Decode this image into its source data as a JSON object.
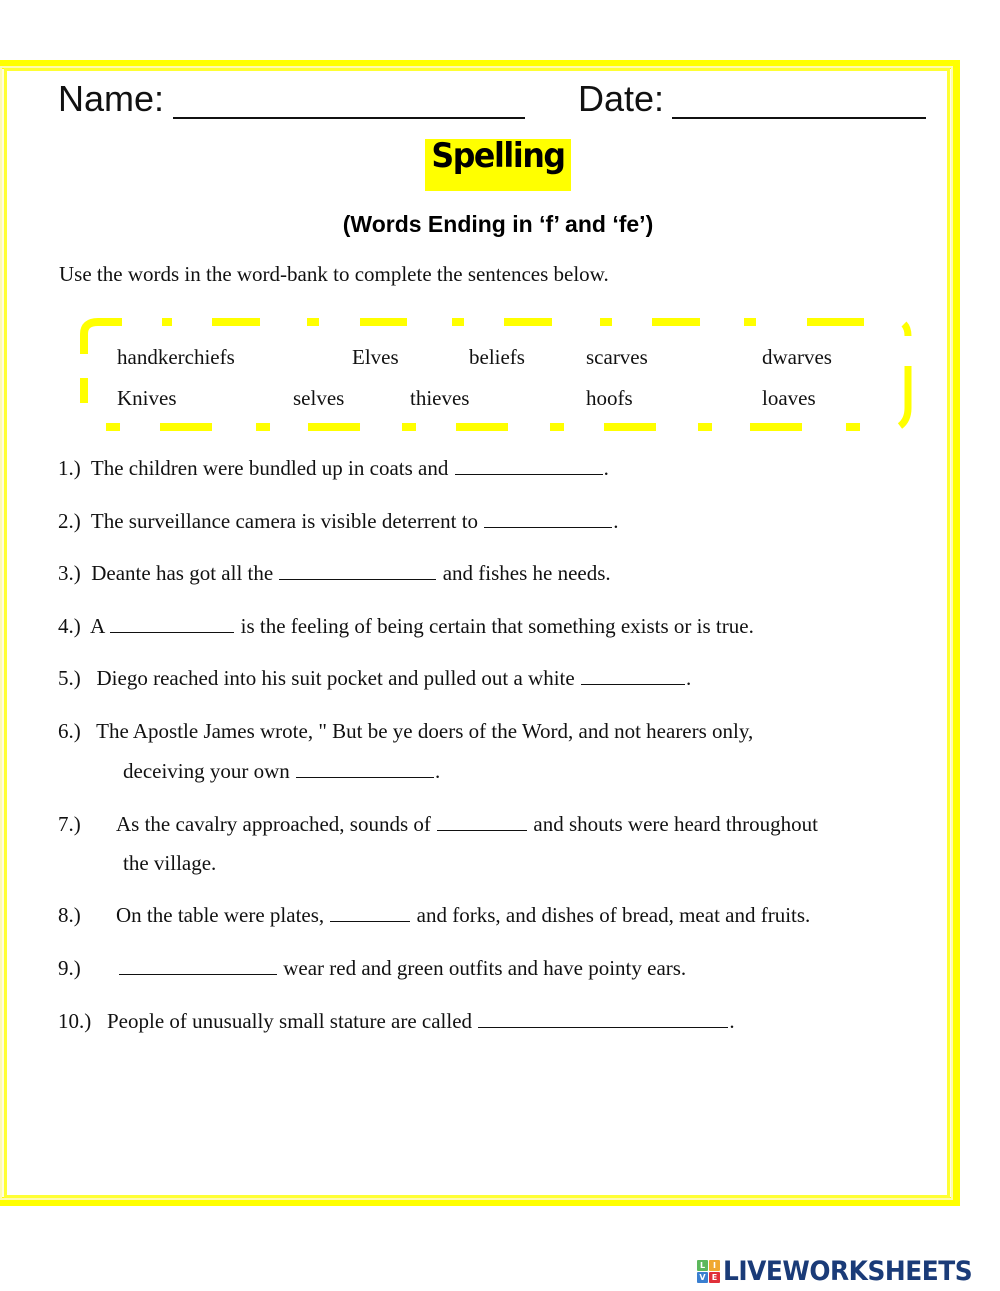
{
  "header": {
    "name_label": "Name:",
    "date_label": "Date:"
  },
  "title": "Spelling",
  "subtitle": "(Words Ending in ‘f’ and ‘fe’)",
  "instructions": "Use the words in the word-bank to complete the sentences below.",
  "word_bank": {
    "row1": [
      "handkerchiefs",
      "Elves",
      "beliefs",
      "scarves",
      "dwarves"
    ],
    "row2": [
      "Knives",
      "selves",
      "thieves",
      "hoofs",
      "loaves"
    ]
  },
  "questions": [
    {
      "num": "1.)",
      "before": "The children were bundled up in coats and",
      "after": "."
    },
    {
      "num": "2.)",
      "before": "The surveillance camera is visible deterrent to",
      "after": "."
    },
    {
      "num": "3.)",
      "before": "Deante has got all the",
      "after": "and fishes he needs."
    },
    {
      "num": "4.)",
      "before": "A",
      "after": "is the feeling of being certain that something exists or is true."
    },
    {
      "num": "5.)",
      "before": "Diego reached into his suit pocket and pulled out a white",
      "after": "."
    },
    {
      "num": "6.)",
      "before": "The Apostle James wrote, \" But be ye doers of the Word, and not hearers only,",
      "line2_before": "deceiving your own",
      "after": "."
    },
    {
      "num": "7.)",
      "before": "As the cavalry approached, sounds of",
      "after": "and shouts were heard throughout",
      "line2": "the village."
    },
    {
      "num": "8.)",
      "before": "On the table were plates,",
      "after": "and forks, and dishes of bread, meat and fruits."
    },
    {
      "num": "9.)",
      "before": "",
      "after": "wear red and green outfits and have pointy ears."
    },
    {
      "num": "10.)",
      "before": "People of unusually small stature are called",
      "after": "."
    }
  ],
  "colors": {
    "frame_yellow": "#ffff00",
    "highlight_yellow": "#ffff00",
    "logo_blue": "#1a3b78"
  },
  "logo": {
    "text": "LIVEWORKSHEETS",
    "grid_letters": [
      "L",
      "I",
      "V",
      "E"
    ],
    "grid_colors": [
      "#5cb85c",
      "#f0a830",
      "#3a7fd0",
      "#e0303a"
    ]
  }
}
